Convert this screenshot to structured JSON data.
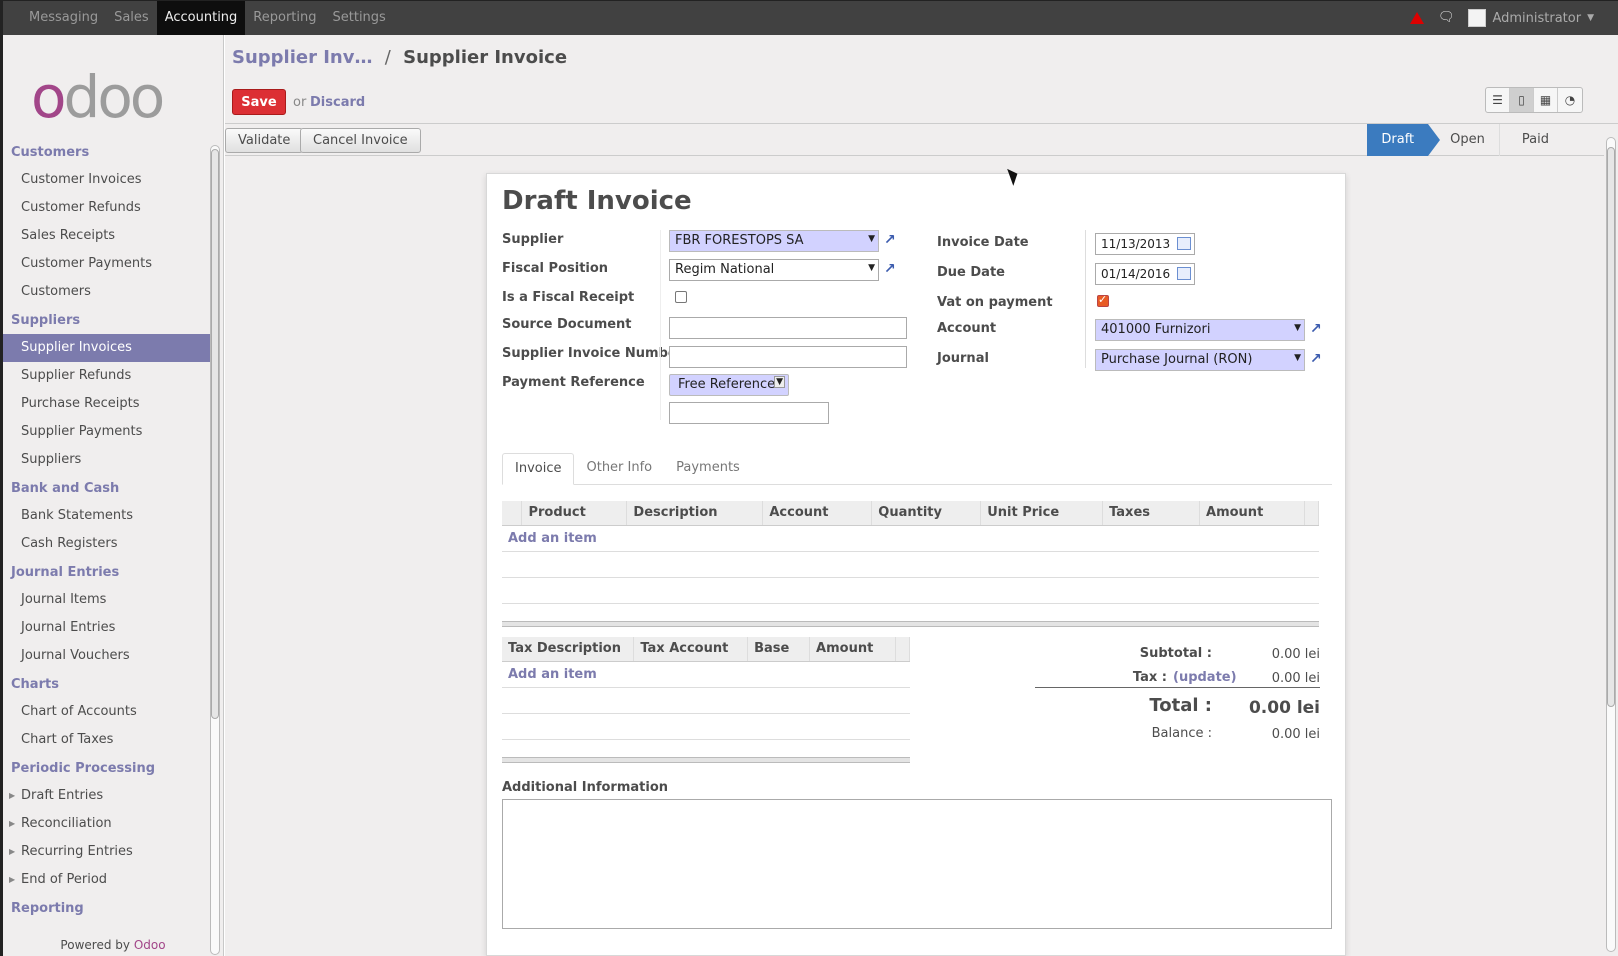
{
  "topbar": {
    "menu": [
      "Messaging",
      "Sales",
      "Accounting",
      "Reporting",
      "Settings"
    ],
    "active": "Accounting",
    "user": "Administrator",
    "icons": [
      "warning-icon",
      "chat-icon",
      "caret-down-icon"
    ]
  },
  "logo": {
    "text": "odoo"
  },
  "sidebar": {
    "sections": [
      {
        "label": "Customers",
        "items": [
          "Customer Invoices",
          "Customer Refunds",
          "Sales Receipts",
          "Customer Payments",
          "Customers"
        ]
      },
      {
        "label": "Suppliers",
        "items": [
          "Supplier Invoices",
          "Supplier Refunds",
          "Purchase Receipts",
          "Supplier Payments",
          "Suppliers"
        ]
      },
      {
        "label": "Bank and Cash",
        "items": [
          "Bank Statements",
          "Cash Registers"
        ]
      },
      {
        "label": "Journal Entries",
        "items": [
          "Journal Items",
          "Journal Entries",
          "Journal Vouchers"
        ]
      },
      {
        "label": "Charts",
        "items": [
          "Chart of Accounts",
          "Chart of Taxes"
        ]
      },
      {
        "label": "Periodic Processing",
        "items": [
          "Draft Entries",
          "Reconciliation",
          "Recurring Entries",
          "End of Period"
        ]
      },
      {
        "label": "Reporting",
        "items": []
      }
    ],
    "active_item": "Supplier Invoices",
    "powered_by": "Powered by",
    "powered_brand": "Odoo"
  },
  "header": {
    "breadcrumb_parent": "Supplier Inv…",
    "breadcrumb_sep": "/",
    "breadcrumb_current": "Supplier Invoice",
    "save_label": "Save",
    "or_text": "or",
    "discard_label": "Discard",
    "views": [
      "list-view-icon",
      "form-view-icon",
      "calendar-view-icon",
      "graph-view-icon"
    ]
  },
  "statusbar": {
    "validate_label": "Validate",
    "cancel_label": "Cancel Invoice",
    "states": [
      "Draft",
      "Open",
      "Paid"
    ],
    "active_state": "Draft"
  },
  "form": {
    "title": "Draft Invoice",
    "left": {
      "supplier_label": "Supplier",
      "supplier_value": "FBR FORESTOPS SA",
      "fiscal_position_label": "Fiscal Position",
      "fiscal_position_value": "Regim National",
      "fiscal_receipt_label": "Is a Fiscal Receipt",
      "fiscal_receipt_checked": false,
      "source_doc_label": "Source Document",
      "source_doc_value": "",
      "supplier_inv_num_label": "Supplier Invoice Number",
      "supplier_inv_num_value": "",
      "payment_ref_label": "Payment Reference",
      "payment_ref_type": "Free Reference",
      "payment_ref_value": ""
    },
    "right": {
      "invoice_date_label": "Invoice Date",
      "invoice_date_value": "11/13/2013",
      "due_date_label": "Due Date",
      "due_date_value": "01/14/2016",
      "vat_label": "Vat on payment",
      "vat_checked": true,
      "account_label": "Account",
      "account_value": "401000 Furnizori",
      "journal_label": "Journal",
      "journal_value": "Purchase Journal (RON)"
    },
    "tabs": [
      "Invoice",
      "Other Info",
      "Payments"
    ],
    "active_tab": "Invoice",
    "lines": {
      "columns": [
        "Product",
        "Description",
        "Account",
        "Quantity",
        "Unit Price",
        "Taxes",
        "Amount"
      ],
      "add_item": "Add an item"
    },
    "taxes": {
      "columns": [
        "Tax Description",
        "Tax Account",
        "Base",
        "Amount"
      ],
      "add_item": "Add an item"
    },
    "totals": {
      "subtotal_label": "Subtotal :",
      "subtotal_value": "0.00 lei",
      "tax_label": "Tax :",
      "tax_update": "(update)",
      "tax_value": "0.00 lei",
      "total_label": "Total :",
      "total_value": "0.00 lei",
      "balance_label": "Balance :",
      "balance_value": "0.00 lei"
    },
    "additional_info_label": "Additional Information",
    "additional_info_value": ""
  },
  "colors": {
    "brand": "#7c7bad",
    "save": "#dc2f34",
    "active_state": "#3b7bbf",
    "many2one": "#d2d2ff"
  }
}
